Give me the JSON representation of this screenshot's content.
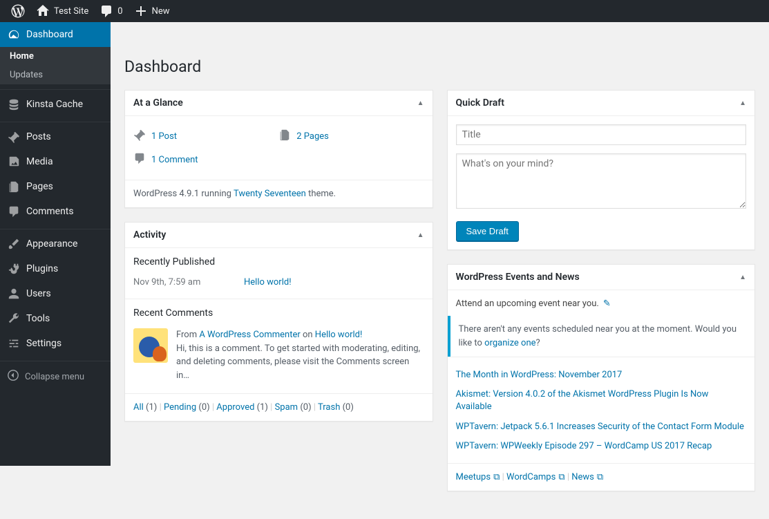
{
  "adminbar": {
    "site_name": "Test Site",
    "comment_count": "0",
    "new_label": "New"
  },
  "sidebar": {
    "dashboard": "Dashboard",
    "home": "Home",
    "updates": "Updates",
    "kinsta_cache": "Kinsta Cache",
    "posts": "Posts",
    "media": "Media",
    "pages": "Pages",
    "comments": "Comments",
    "appearance": "Appearance",
    "plugins": "Plugins",
    "users": "Users",
    "tools": "Tools",
    "settings": "Settings",
    "collapse": "Collapse menu"
  },
  "page_title": "Dashboard",
  "glance": {
    "title": "At a Glance",
    "posts": "1 Post",
    "pages": "2 Pages",
    "comments": "1 Comment",
    "version_pre": "WordPress 4.9.1 running ",
    "theme": "Twenty Seventeen",
    "version_post": " theme."
  },
  "activity": {
    "title": "Activity",
    "recently_published": "Recently Published",
    "pub_date": "Nov 9th, 7:59 am",
    "pub_title": "Hello world!",
    "recent_comments": "Recent Comments",
    "comment_from": "From ",
    "comment_author": "A WordPress Commenter",
    "comment_on": " on ",
    "comment_post": "Hello world!",
    "comment_text": "Hi, this is a comment. To get started with moderating, editing, and deleting comments, please visit the Comments screen in…",
    "filters": {
      "all": "All",
      "all_c": "(1)",
      "pending": "Pending",
      "pending_c": "(0)",
      "approved": "Approved",
      "approved_c": "(1)",
      "spam": "Spam",
      "spam_c": "(0)",
      "trash": "Trash",
      "trash_c": "(0)"
    }
  },
  "quickdraft": {
    "title": "Quick Draft",
    "title_placeholder": "Title",
    "content_placeholder": "What's on your mind?",
    "save": "Save Draft"
  },
  "events": {
    "title": "WordPress Events and News",
    "attend": "Attend an upcoming event near you.",
    "no_events_pre": "There aren't any events scheduled near you at the moment. Would you like to ",
    "organize": "organize one",
    "no_events_post": "?",
    "news": [
      "The Month in WordPress: November 2017",
      "Akismet: Version 4.0.2 of the Akismet WordPress Plugin Is Now Available",
      "WPTavern: Jetpack 5.6.1 Increases Security of the Contact Form Module",
      "WPTavern: WPWeekly Episode 297 – WordCamp US 2017 Recap"
    ],
    "footer": {
      "meetups": "Meetups",
      "wordcamps": "WordCamps",
      "news_label": "News"
    }
  }
}
